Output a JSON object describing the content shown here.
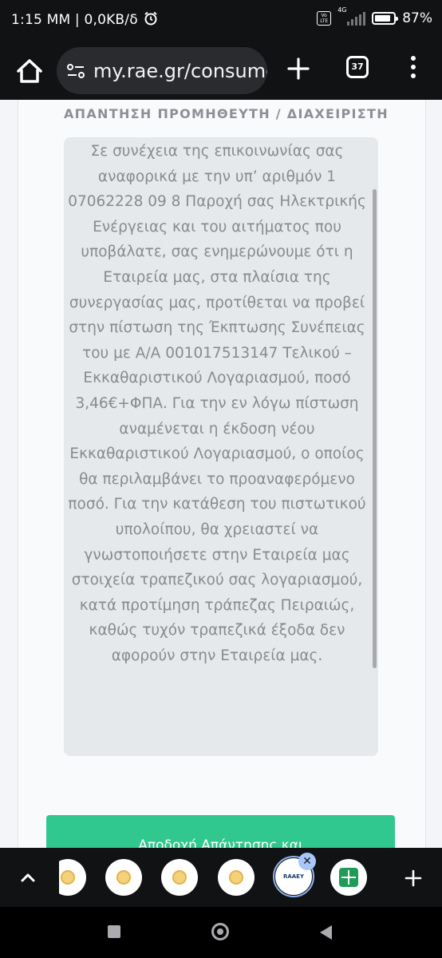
{
  "status_bar": {
    "left_text": "1:15 ΜΜ | 0,0KB/δ",
    "network": "4G",
    "volte": "Vo LTE",
    "battery": "87%"
  },
  "browser": {
    "url": "my.rae.gr/consume",
    "tab_count": "37"
  },
  "page": {
    "section_title": "ΑΠΑΝΤΗΣΗ ΠΡΟΜΗΘΕΥΤΗ / ΔΙΑΧΕΙΡΙΣΤΗ",
    "response_text": "Σε συνέχεια της επικοινωνίας σας αναφορικά με την υπ’ αριθμόν 1 07062228 09 8 Παροχή σας Ηλεκτρικής Ενέργειας και του αιτήματος που υποβάλατε, σας ενημερώνουμε ότι η Εταιρεία μας, στα πλαίσια της συνεργασίας μας, προτίθεται να προβεί στην πίστωση της Έκπτωσης Συνέπειας του με Α/Α 001017513147 Τελικού – Εκκαθαριστικού Λογαριασμού, ποσό 3,46€+ΦΠΑ. Για την εν λόγω πίστωση αναμένεται η έκδοση νέου Εκκαθαριστικού Λογαριασμού, ο οποίος θα περιλαμβάνει το προαναφερόμενο ποσό. Για την κατάθεση του πιστωτικού υπολοίπου, θα χρειαστεί να γνωστοποιήσετε στην Εταιρεία μας στοιχεία τραπεζικού σας λογαριασμού, κατά προτίμηση τράπεζας Πειραιώς, καθώς τυχόν τραπεζικά έξοδα δεν αφορούν στην Εταιρεία μας.",
    "accept_button": "Αποδοχή Απάντησης και"
  },
  "tab_strip": {
    "active_tab_logo": "RAAEY",
    "close_symbol": "✕",
    "tab_icons": [
      "site-favicon",
      "site-favicon",
      "site-favicon",
      "site-favicon",
      "raaey-logo",
      "sheets-icon"
    ]
  },
  "colors": {
    "accent_button": "#30c88f",
    "active_ring": "#8eb2f2"
  }
}
